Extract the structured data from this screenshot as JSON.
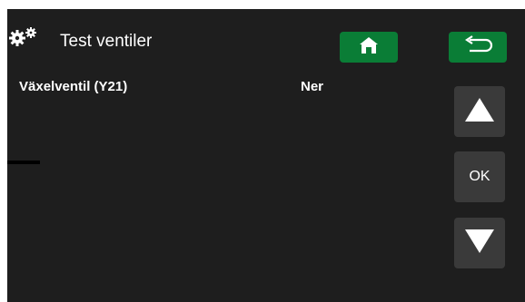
{
  "header": {
    "title": "Test ventiler",
    "settings_icon": "gears-icon",
    "home_icon": "home-icon",
    "back_icon": "return-arrow-icon",
    "accent_color": "#0a7d36"
  },
  "rows": [
    {
      "label": "Växelventil (Y21)",
      "value": "Ner"
    }
  ],
  "nav": {
    "up_icon": "triangle-up-icon",
    "ok_label": "OK",
    "down_icon": "triangle-down-icon"
  }
}
